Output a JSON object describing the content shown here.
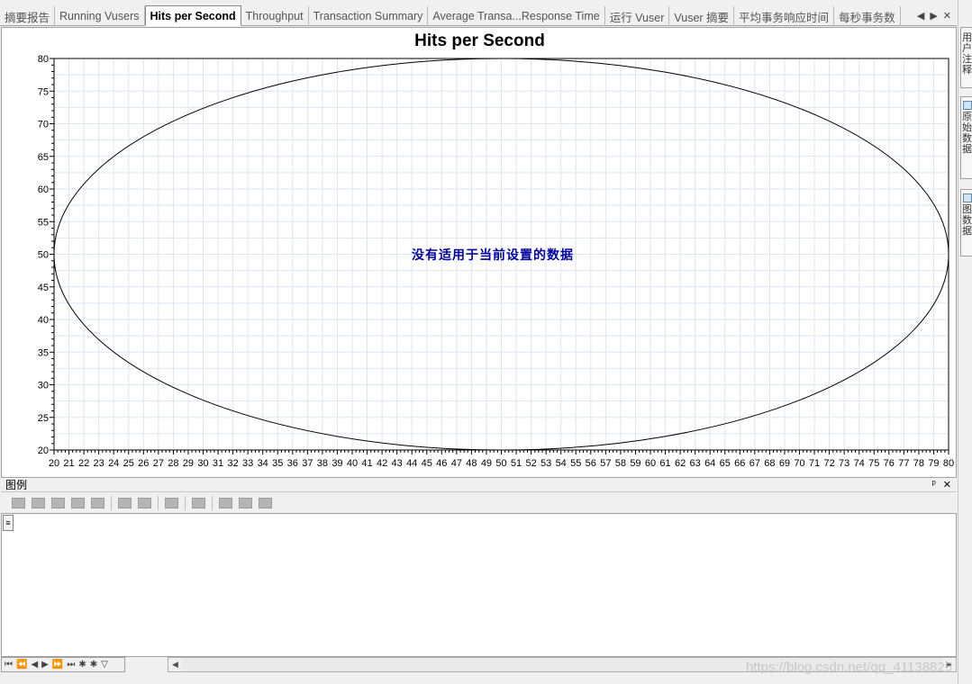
{
  "tabs": [
    {
      "label": "摘要报告",
      "active": false
    },
    {
      "label": "Running Vusers",
      "active": false
    },
    {
      "label": "Hits per Second",
      "active": true
    },
    {
      "label": "Throughput",
      "active": false
    },
    {
      "label": "Transaction Summary",
      "active": false
    },
    {
      "label": "Average Transa...Response Time",
      "active": false
    },
    {
      "label": "运行 Vuser",
      "active": false
    },
    {
      "label": "Vuser 摘要",
      "active": false
    },
    {
      "label": "平均事务响应时间",
      "active": false
    },
    {
      "label": "每秒事务数",
      "active": false
    }
  ],
  "tab_controls": {
    "prev": "◀",
    "next": "▶",
    "close": "✕"
  },
  "chart": {
    "title": "Hits per Second",
    "no_data_message": "没有适用于当前设置的数据"
  },
  "chart_data": {
    "type": "line",
    "title": "Hits per Second",
    "xlabel": "",
    "ylabel": "",
    "xlim": [
      20,
      80
    ],
    "ylim": [
      20,
      80
    ],
    "x_ticks": [
      20,
      21,
      22,
      23,
      24,
      25,
      26,
      27,
      28,
      29,
      30,
      31,
      32,
      33,
      34,
      35,
      36,
      37,
      38,
      39,
      40,
      41,
      42,
      43,
      44,
      45,
      46,
      47,
      48,
      49,
      50,
      51,
      52,
      53,
      54,
      55,
      56,
      57,
      58,
      59,
      60,
      61,
      62,
      63,
      64,
      65,
      66,
      67,
      68,
      69,
      70,
      71,
      72,
      73,
      74,
      75,
      76,
      77,
      78,
      79,
      80
    ],
    "y_ticks": [
      20,
      25,
      30,
      35,
      40,
      45,
      50,
      55,
      60,
      65,
      70,
      75,
      80
    ],
    "grid": true,
    "series": [],
    "placeholder_shape": {
      "center": [
        50,
        50
      ],
      "rx": 30,
      "ry": 30
    }
  },
  "legend": {
    "title": "图例",
    "pin": "ᵖ",
    "close": "✕",
    "row_handle": "≡"
  },
  "navigator": {
    "first": "⏮",
    "prev_page": "⏪",
    "prev": "◀",
    "next": "▶",
    "next_page": "⏩",
    "last": "⏭",
    "new": "✱",
    "new2": "✱",
    "filter": "▽"
  },
  "right_dock": [
    {
      "label": "用户注释",
      "icon": "note-icon"
    },
    {
      "label": "原始数据",
      "icon": "data-icon"
    },
    {
      "label": "图数据",
      "icon": "graph-data-icon"
    }
  ],
  "watermark": "https://blog.csdn.net/qq_41138825"
}
